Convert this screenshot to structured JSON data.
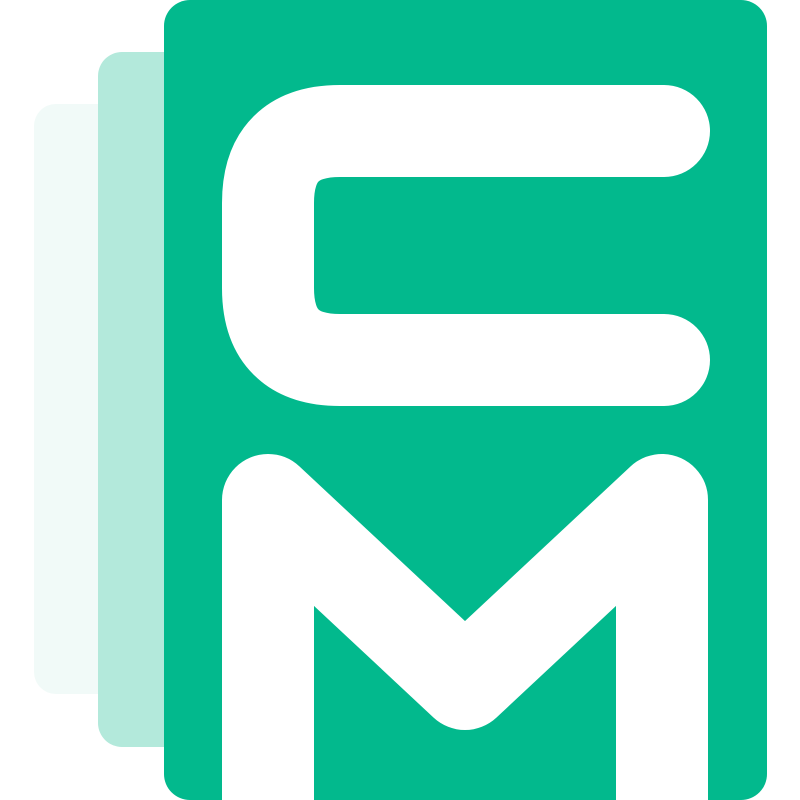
{
  "logo": {
    "text": "CM",
    "colors": {
      "primary": "#02B98D",
      "middle_layer": "#B3E9DB",
      "back_layer": "#F1FAF8",
      "glyph": "#FFFFFF"
    }
  }
}
